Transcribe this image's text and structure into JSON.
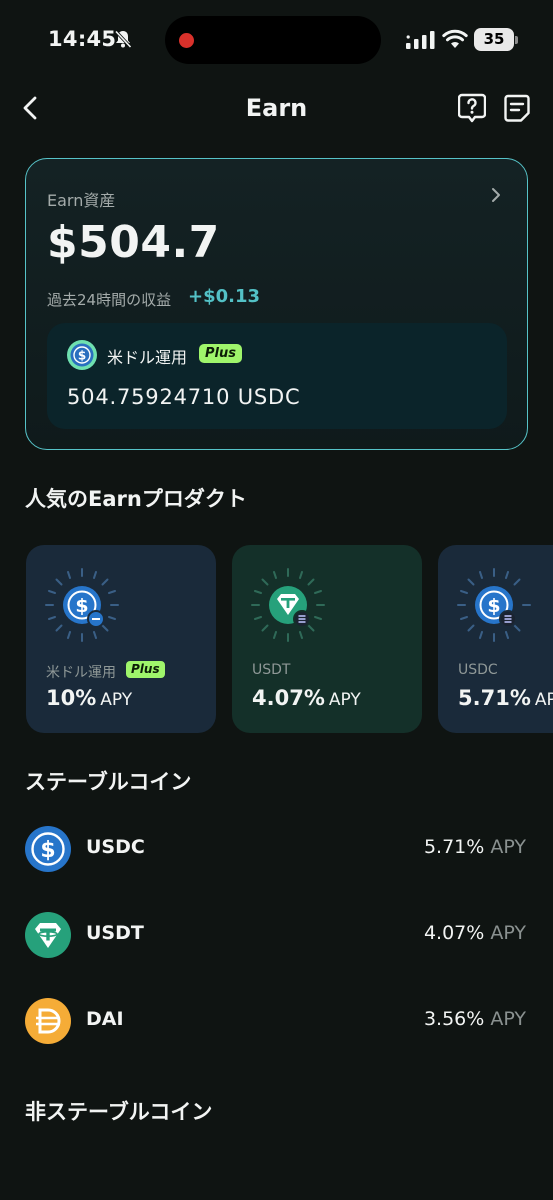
{
  "status_bar": {
    "time": "14:45",
    "battery": "35"
  },
  "nav": {
    "title": "Earn"
  },
  "asset_card": {
    "label": "Earn資産",
    "amount": "$504.7",
    "earnings_label": "過去24時間の収益",
    "earnings_value": "+$0.13",
    "product": {
      "name": "米ドル運用",
      "badge": "Plus",
      "balance": "504.75924710 USDC"
    }
  },
  "popular": {
    "title": "人気のEarnプロダクト",
    "items": [
      {
        "label": "米ドル運用",
        "badge": "Plus",
        "rate": "10%",
        "apy": "APY"
      },
      {
        "label": "USDT",
        "rate": "4.07%",
        "apy": "APY"
      },
      {
        "label": "USDC",
        "rate": "5.71%",
        "apy": "APY"
      }
    ]
  },
  "stablecoins": {
    "title": "ステーブルコイン",
    "items": [
      {
        "name": "USDC",
        "rate": "5.71%",
        "apy": "APY"
      },
      {
        "name": "USDT",
        "rate": "4.07%",
        "apy": "APY"
      },
      {
        "name": "DAI",
        "rate": "3.56%",
        "apy": "APY"
      }
    ]
  },
  "non_stable": {
    "title": "非ステーブルコイン"
  },
  "colors": {
    "background": "#0f1412",
    "accent_teal": "#53c1c6",
    "plus_badge": "#9ff56b",
    "usdc_blue": "#2775ca",
    "usdt_green": "#26a17b",
    "dai_yellow": "#f5ac37"
  },
  "icons": [
    "bell-slash-icon",
    "signal-icon",
    "wifi-icon",
    "back-arrow-icon",
    "help-icon",
    "history-icon",
    "chevron-right-icon",
    "usdc-icon",
    "usdt-icon",
    "dai-icon"
  ]
}
